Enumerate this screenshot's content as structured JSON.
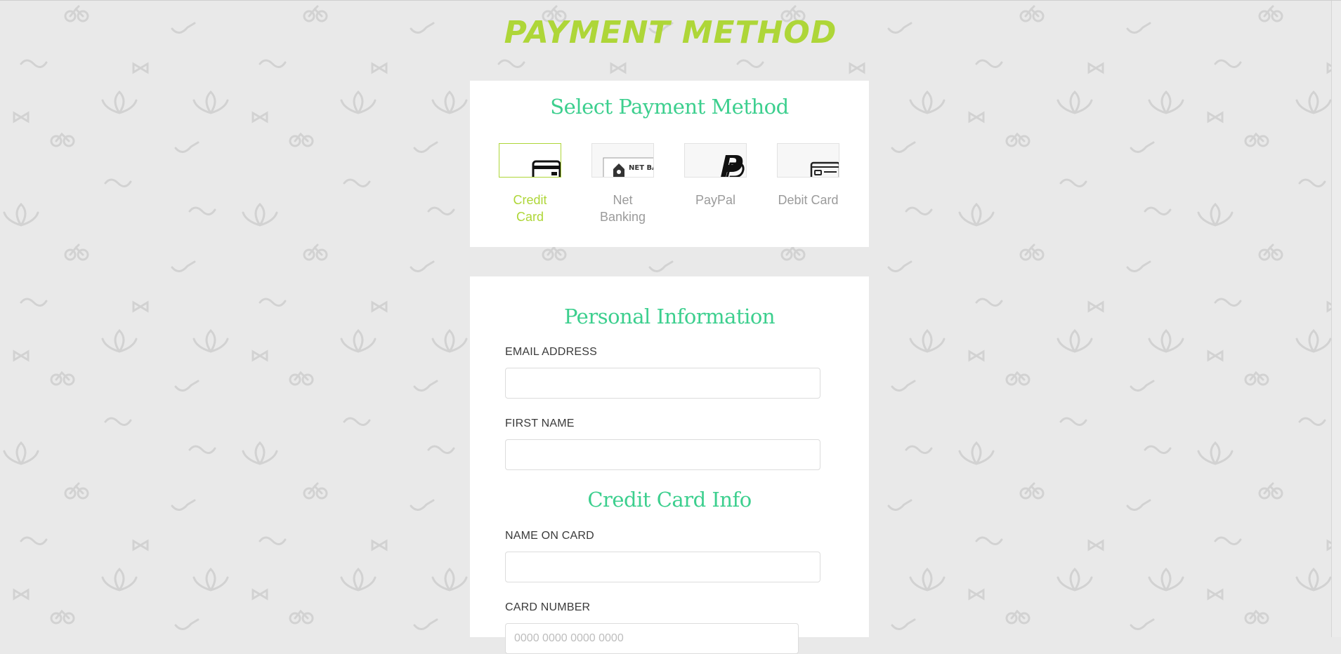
{
  "page_title": "PAYMENT METHOD",
  "methods_section": {
    "heading": "Select Payment Method",
    "options": [
      {
        "label": "Credit Card",
        "icon": "credit-card-icon",
        "selected": true
      },
      {
        "label": "Net Banking",
        "icon": "net-banking-icon",
        "selected": false,
        "thumb_text": "NET BANKI"
      },
      {
        "label": "PayPal",
        "icon": "paypal-icon",
        "selected": false
      },
      {
        "label": "Debit Card",
        "icon": "debit-card-icon",
        "selected": false
      }
    ]
  },
  "form": {
    "personal_heading": "Personal Information",
    "email_label": "EMAIL ADDRESS",
    "email_value": "",
    "first_name_label": "FIRST NAME",
    "first_name_value": "",
    "card_heading": "Credit Card Info",
    "name_on_card_label": "NAME ON CARD",
    "name_on_card_value": "",
    "card_number_label": "CARD NUMBER",
    "card_number_placeholder": "0000 0000 0000 0000"
  },
  "colors": {
    "accent_lime": "#aed638",
    "accent_green": "#3ccf8e",
    "background": "#e9e9e9"
  }
}
